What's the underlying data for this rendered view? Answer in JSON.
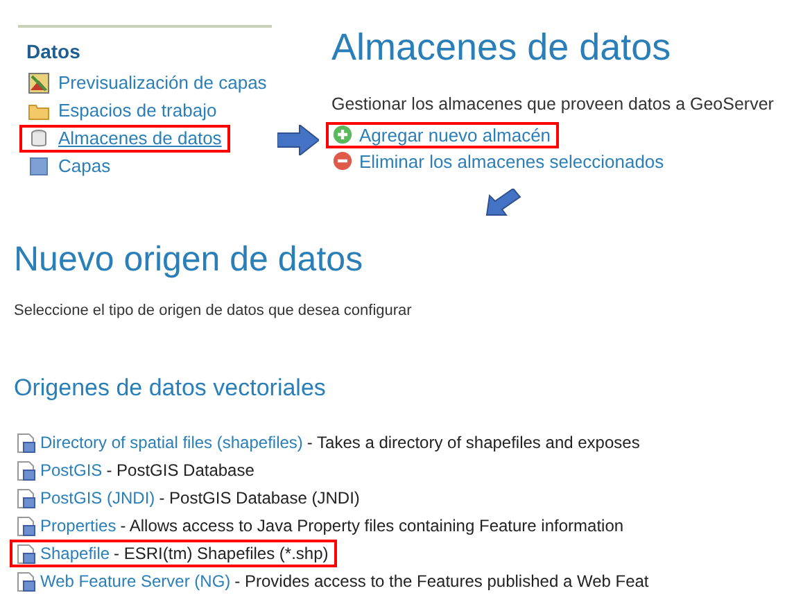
{
  "sidebar": {
    "heading": "Datos",
    "items": [
      {
        "label": "Previsualización de capas",
        "kind": "preview",
        "highlighted": false
      },
      {
        "label": "Espacios de trabajo",
        "kind": "folder",
        "highlighted": false
      },
      {
        "label": "Almacenes de datos",
        "kind": "store",
        "highlighted": true
      },
      {
        "label": "Capas",
        "kind": "layers",
        "highlighted": false
      }
    ]
  },
  "stores_page": {
    "title": "Almacenes de datos",
    "description": "Gestionar los almacenes que proveen datos a GeoServer",
    "actions": [
      {
        "label": "Agregar nuevo almacén",
        "kind": "add",
        "highlighted": true
      },
      {
        "label": "Eliminar los almacenes seleccionados",
        "kind": "remove",
        "highlighted": false
      }
    ]
  },
  "new_source_page": {
    "title": "Nuevo origen de datos",
    "description": "Seleccione el tipo de origen de datos que desea configurar",
    "section_title": "Origenes de datos vectoriales",
    "sources": [
      {
        "name": "Directory of spatial files (shapefiles)",
        "description": "- Takes a directory of shapefiles and exposes",
        "highlighted": false
      },
      {
        "name": "PostGIS",
        "description": "- PostGIS Database",
        "highlighted": false
      },
      {
        "name": "PostGIS (JNDI)",
        "description": "- PostGIS Database (JNDI)",
        "highlighted": false
      },
      {
        "name": "Properties",
        "description": "- Allows access to Java Property files containing Feature information",
        "highlighted": false
      },
      {
        "name": "Shapefile",
        "description": "- ESRI(tm) Shapefiles (*.shp)",
        "highlighted": true
      },
      {
        "name": "Web Feature Server (NG)",
        "description": "- Provides access to the Features published a Web Feat",
        "highlighted": false
      }
    ]
  }
}
